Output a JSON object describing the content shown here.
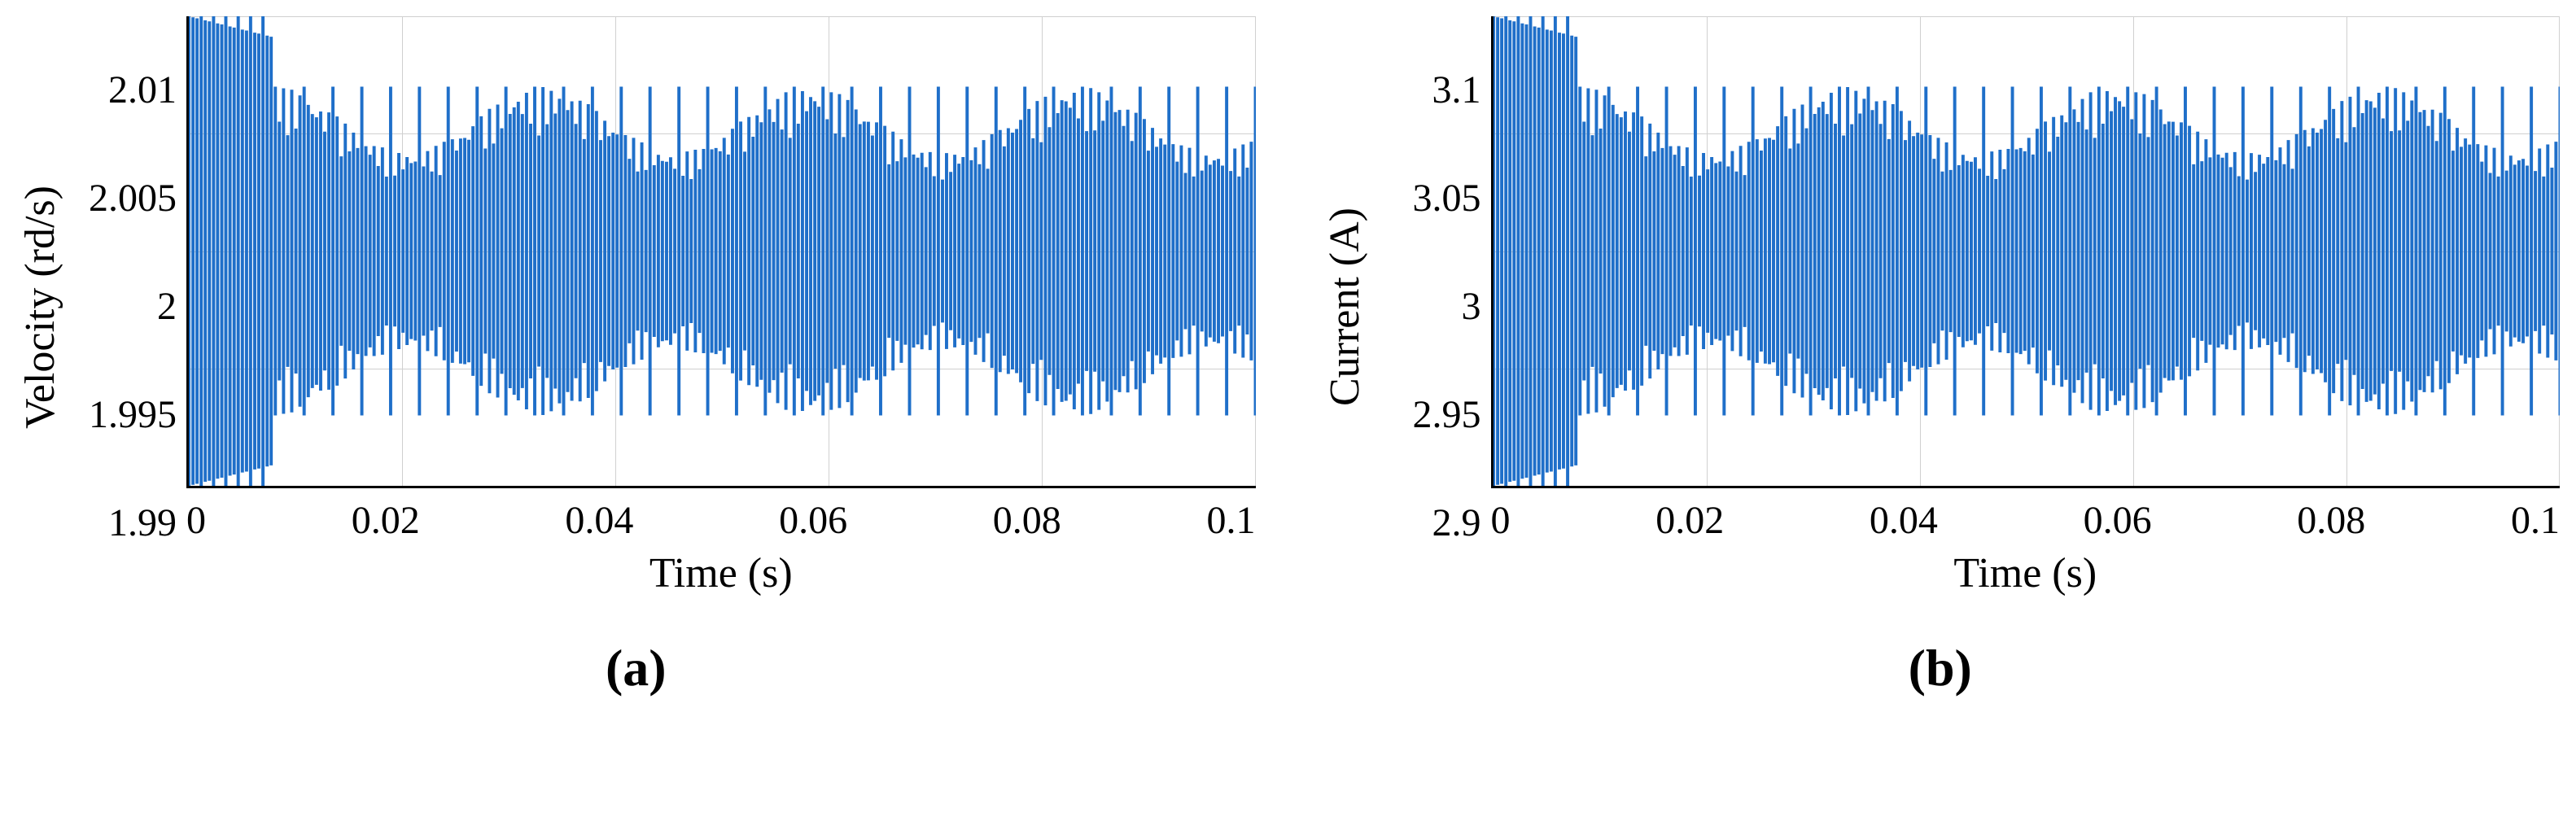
{
  "chart_data": [
    {
      "type": "line",
      "panel": "a",
      "xlabel": "Time  (s)",
      "ylabel": "Velocity (rd/s)",
      "xlim": [
        0,
        0.1
      ],
      "ylim": [
        1.99,
        2.01
      ],
      "xticks": [
        "0",
        "0.02",
        "0.04",
        "0.06",
        "0.08",
        "0.1"
      ],
      "yticks": [
        "2.01",
        "2.005",
        "2",
        "1.995",
        "1.99"
      ],
      "color": "#1f6fc9",
      "description": "Dense high-frequency oscillation around 2.0 rd/s; initial peaks near 2.01, settling to envelope approximately 1.993–2.007 after ~0.008 s.",
      "envelope": {
        "center": 2.0,
        "initial_peak": 2.01,
        "initial_trough": 1.99,
        "steady_peak": 2.007,
        "steady_trough": 1.993,
        "transient_end_s": 0.008
      }
    },
    {
      "type": "line",
      "panel": "b",
      "xlabel": "Time  (s)",
      "ylabel": "Current (A)",
      "xlim": [
        0,
        0.1
      ],
      "ylim": [
        2.9,
        3.1
      ],
      "xticks": [
        "0",
        "0.02",
        "0.04",
        "0.06",
        "0.08",
        "0.1"
      ],
      "yticks": [
        "3.1",
        "3.05",
        "3",
        "2.95",
        "2.9"
      ],
      "color": "#1f6fc9",
      "description": "Dense high-frequency oscillation around 3.0 A; initial peaks near 3.1, settling to envelope approximately 2.93–3.07 after ~0.008 s.",
      "envelope": {
        "center": 3.0,
        "initial_peak": 3.1,
        "initial_trough": 2.9,
        "steady_peak": 3.07,
        "steady_trough": 2.93,
        "transient_end_s": 0.008
      }
    }
  ],
  "captions": {
    "a": "(a)",
    "b": "(b)"
  }
}
